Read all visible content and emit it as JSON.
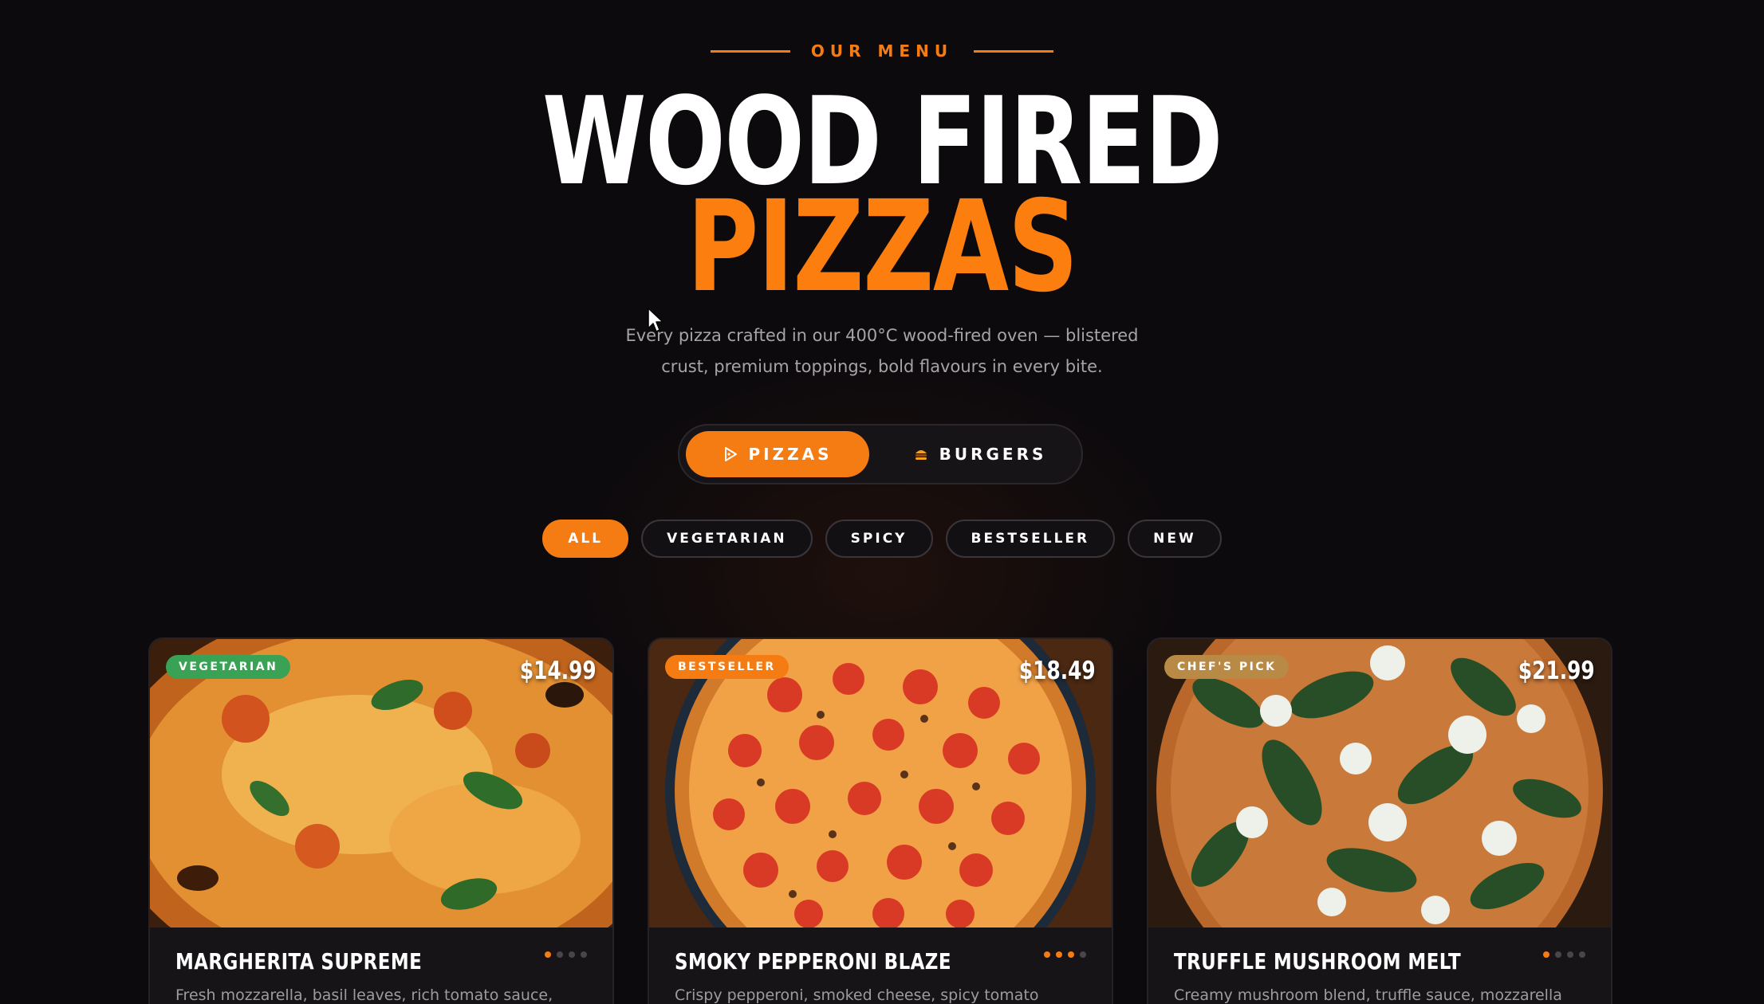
{
  "header": {
    "eyebrow": "OUR MENU",
    "title_line1": "WOOD FIRED",
    "title_line2": "PIZZAS",
    "lead": "Every pizza crafted in our 400°C wood-fired oven — blistered crust, premium toppings, bold flavours in every bite."
  },
  "switcher": {
    "pizzas_label": "PIZZAS",
    "burgers_label": "BURGERS",
    "selected": "PIZZAS"
  },
  "filters": {
    "items": [
      {
        "label": "ALL"
      },
      {
        "label": "VEGETARIAN"
      },
      {
        "label": "SPICY"
      },
      {
        "label": "BESTSELLER"
      },
      {
        "label": "NEW"
      }
    ],
    "selected": "ALL"
  },
  "cards": [
    {
      "badge": "VEGETARIAN",
      "badge_color": "#3aa255",
      "price": "$14.99",
      "name": "MARGHERITA SUPREME",
      "desc": "Fresh mozzarella, basil leaves, rich tomato sauce,",
      "spice_level": 1,
      "spice_max": 4
    },
    {
      "badge": "BESTSELLER",
      "badge_color": "#f57c12",
      "price": "$18.49",
      "name": "SMOKY PEPPERONI BLAZE",
      "desc": "Crispy pepperoni, smoked cheese, spicy tomato",
      "spice_level": 3,
      "spice_max": 4
    },
    {
      "badge": "CHEF'S PICK",
      "badge_color": "#b98a45",
      "price": "$21.99",
      "name": "TRUFFLE MUSHROOM MELT",
      "desc": "Creamy mushroom blend, truffle sauce, mozzarella",
      "spice_level": 1,
      "spice_max": 4
    }
  ],
  "colors": {
    "accent": "#f57c12",
    "background": "#0c0a0d"
  }
}
